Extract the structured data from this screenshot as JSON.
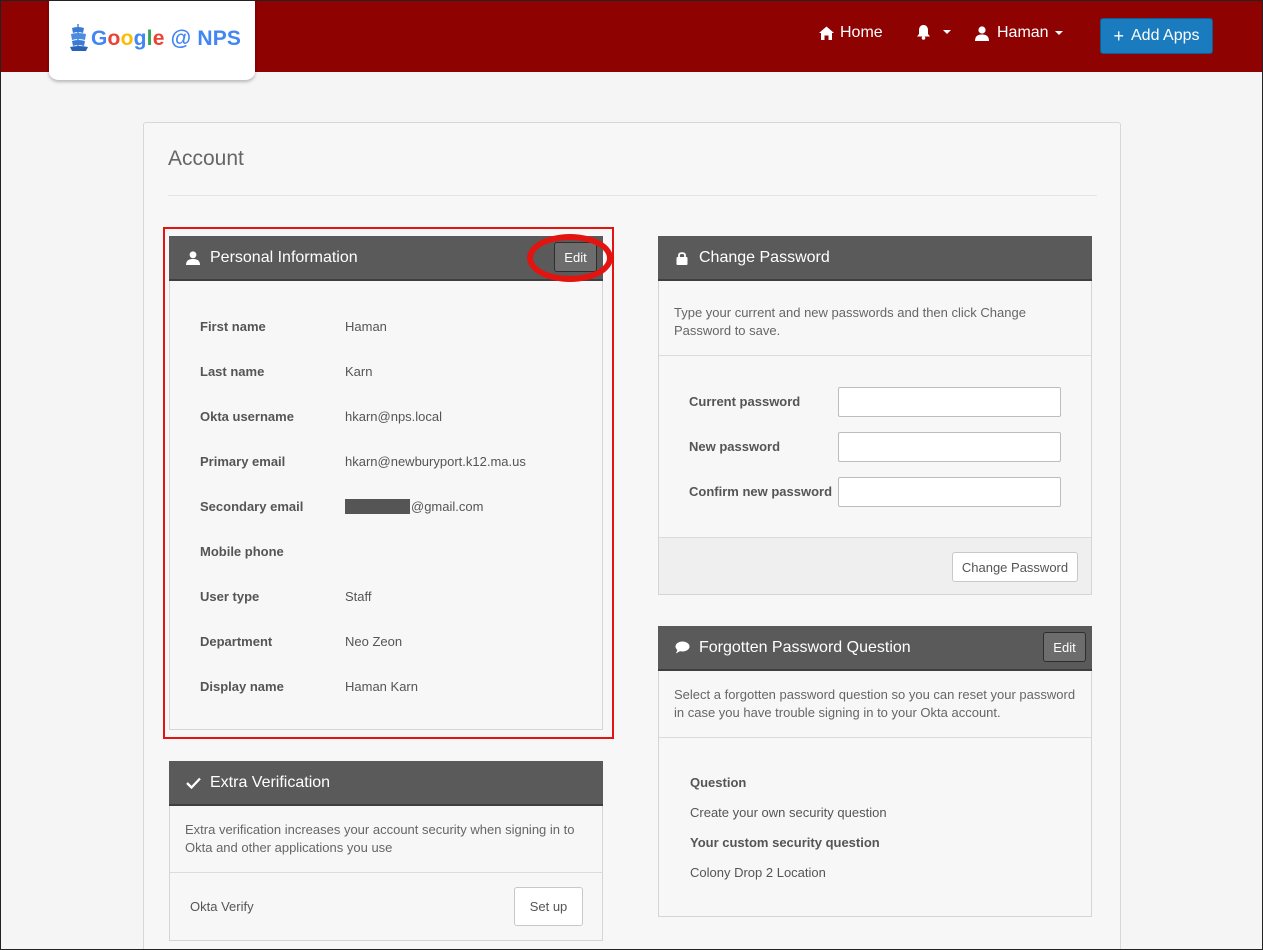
{
  "header": {
    "logo": {
      "google": [
        "G",
        "o",
        "o",
        "g",
        "l",
        "e"
      ],
      "suffix": "@ NPS"
    },
    "nav": {
      "home": "Home",
      "user": "Haman"
    },
    "add_apps": "Add Apps"
  },
  "account": {
    "title": "Account"
  },
  "personal": {
    "title": "Personal Information",
    "edit": "Edit",
    "fields": [
      {
        "label": "First name",
        "value": "Haman"
      },
      {
        "label": "Last name",
        "value": "Karn"
      },
      {
        "label": "Okta username",
        "value": "hkarn@nps.local"
      },
      {
        "label": "Primary email",
        "value": "hkarn@newburyport.k12.ma.us"
      },
      {
        "label": "Secondary email",
        "value": "@gmail.com"
      },
      {
        "label": "Mobile phone",
        "value": ""
      },
      {
        "label": "User type",
        "value": "Staff"
      },
      {
        "label": "Department",
        "value": "Neo Zeon"
      },
      {
        "label": "Display name",
        "value": "Haman Karn"
      }
    ]
  },
  "change_password": {
    "title": "Change Password",
    "description": "Type your current and new passwords and then click Change Password to save.",
    "current_label": "Current password",
    "new_label": "New password",
    "confirm_label": "Confirm new password",
    "submit": "Change Password"
  },
  "forgotten": {
    "title": "Forgotten Password Question",
    "edit": "Edit",
    "description": "Select a forgotten password question so you can reset your password in case you have trouble signing in to your Okta account.",
    "question_label": "Question",
    "question_value": "Create your own security question",
    "custom_label": "Your custom security question",
    "custom_value": "Colony Drop 2 Location"
  },
  "extra": {
    "title": "Extra Verification",
    "description": "Extra verification increases your account security when signing in to Okta and other applications you use",
    "factor": "Okta Verify",
    "setup": "Set up"
  },
  "colors": {
    "header_bg": "#8e0202",
    "panel_head": "#5a5a5a",
    "primary_button": "#1a7bbf",
    "highlight": "#e3140f",
    "google": [
      "#4285f4",
      "#ea4335",
      "#fbbc05",
      "#4285f4",
      "#34a853",
      "#ea4335"
    ],
    "nps": "#4285f4"
  }
}
